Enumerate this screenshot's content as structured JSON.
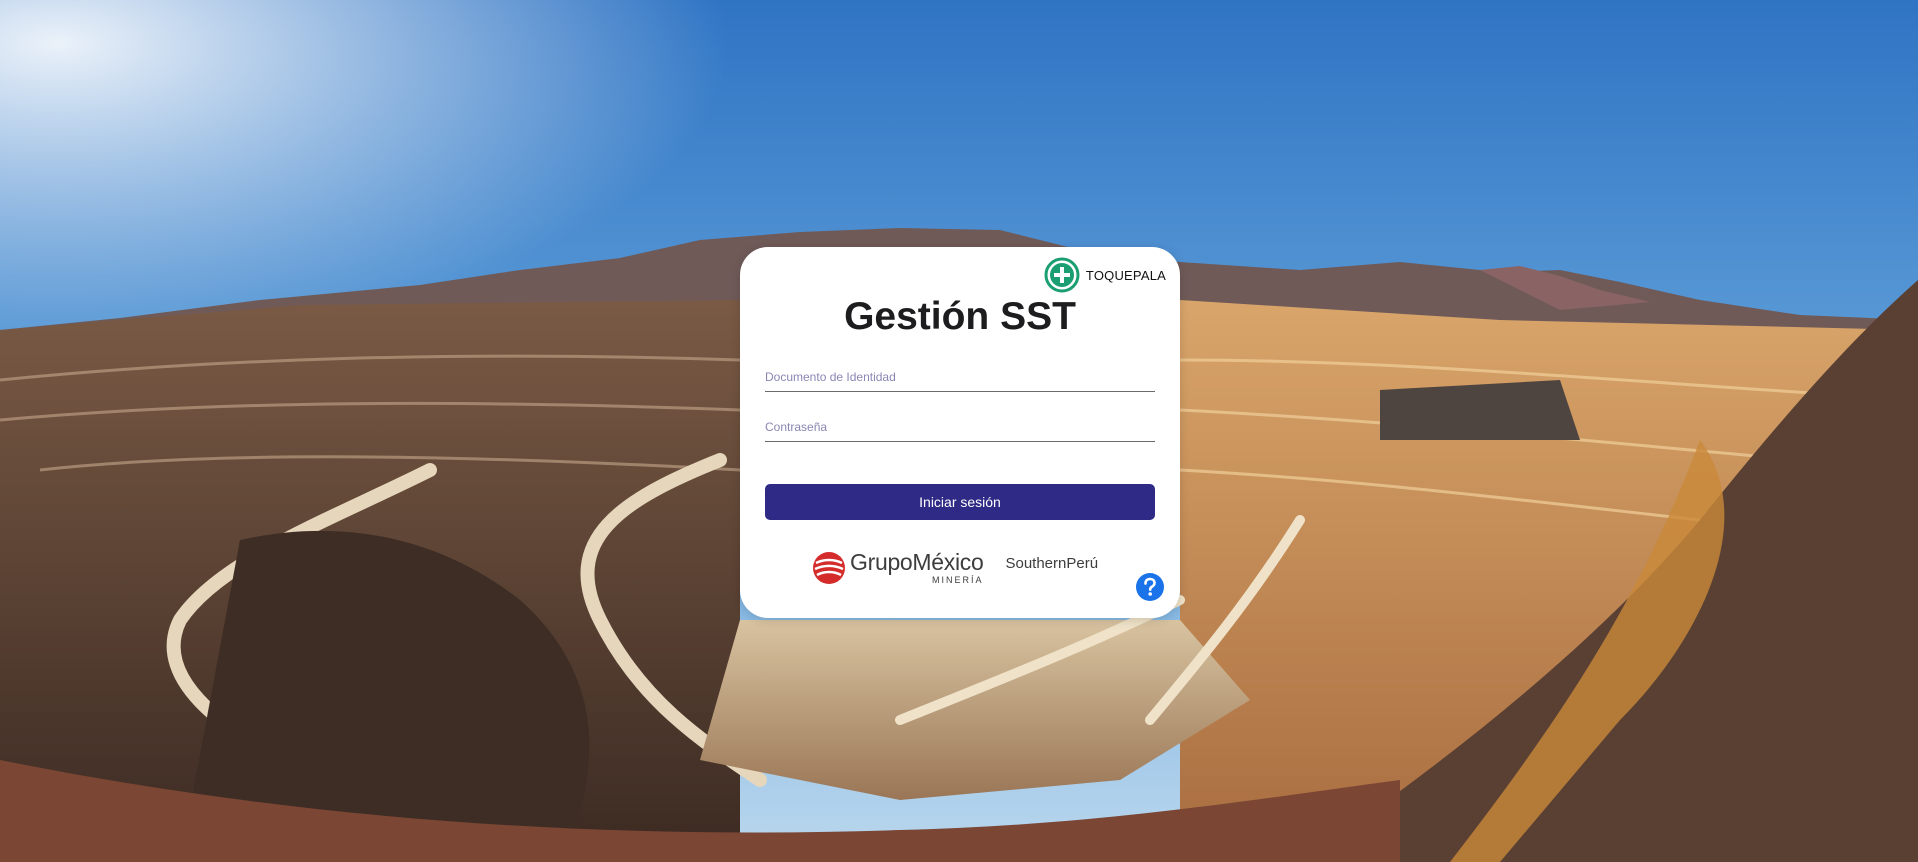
{
  "background": {
    "description_icon": "open-pit-mine-landscape"
  },
  "login_card": {
    "site_badge": {
      "icon": "green-cross-icon",
      "label": "TOQUEPALA",
      "color": "#1a9e72"
    },
    "title": "Gestión SST",
    "document_field": {
      "placeholder": "Documento de Identidad",
      "value": ""
    },
    "password_field": {
      "placeholder": "Contraseña",
      "value": ""
    },
    "login_button": {
      "label": "Iniciar sesión",
      "color": "#2e2a86"
    },
    "logos": {
      "grupo_mexico": {
        "name": "GrupoMéxico",
        "subtitle": "MINERÍA",
        "brand_color": "#d42b2b"
      },
      "southern_peru": {
        "name": "SouthernPerú"
      }
    },
    "help_button": {
      "icon": "question-circle-icon",
      "color": "#1a73e8"
    }
  }
}
